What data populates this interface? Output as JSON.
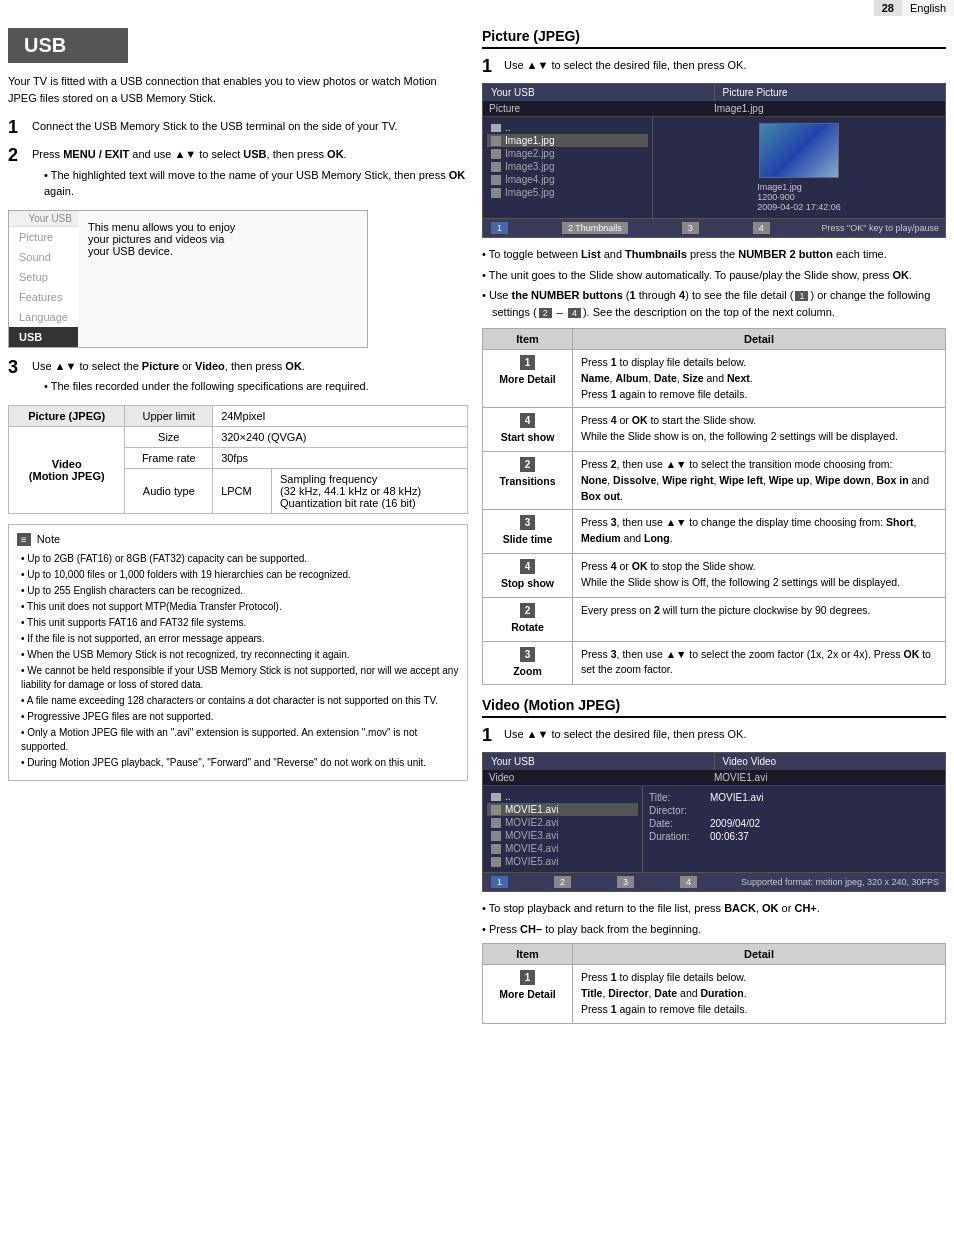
{
  "page": {
    "number": "28",
    "language": "English"
  },
  "left": {
    "usb_title": "USB",
    "intro": "Your TV is fitted with a USB connection that enables you to view photos or watch Motion JPEG files stored on a USB Memory Stick.",
    "step1_number": "1",
    "step1_text": "Connect the USB Memory Stick to the USB terminal on the side of your TV.",
    "step2_number": "2",
    "step2_text": "Press MENU / EXIT and use ▲▼ to select USB, then press OK.",
    "step2_bullet": "The highlighted text will move to the name of your USB Memory Stick, then press OK again.",
    "menu_items": [
      "Picture",
      "Sound",
      "Setup",
      "Features",
      "Language",
      "USB"
    ],
    "menu_your_usb": "Your USB",
    "menu_desc_line1": "This menu allows you to enjoy",
    "menu_desc_line2": "your pictures and videos via",
    "menu_desc_line3": "your USB device.",
    "step3_number": "3",
    "step3_text": "Use ▲▼ to select the Picture or Video, then press OK.",
    "step3_bullet": "The files recorded under the following specifications are required.",
    "spec_headers": [
      "Picture (JPEG)",
      "",
      "Upper limit",
      "24Mpixel"
    ],
    "spec_video_label": "Video\n(Motion JPEG)",
    "spec_size_label": "Size",
    "spec_size_value": "320×240 (QVGA)",
    "spec_frame_label": "Frame rate",
    "spec_frame_value": "30fps",
    "spec_audio_label": "Audio type",
    "spec_audio_codec": "LPCM",
    "spec_audio_desc": "Sampling frequency\n(32 kHz, 44.1 kHz or 48 kHz)\nQuantization bit rate (16 bit)",
    "note_label": "Note",
    "notes": [
      "Up to 2GB (FAT16) or 8GB (FAT32) capacity can be supported.",
      "Up to 10,000 files or 1,000 folders with 19 hierarchies can be recognized.",
      "Up to 255 English characters can be recognized.",
      "This unit does not support MTP(Media Transfer Protocol).",
      "This unit supports FAT16 and FAT32 file systems.",
      "If the file is not supported, an error message appears.",
      "When the USB Memory Stick is not recognized, try reconnecting it again.",
      "We cannot be held responsible if your USB Memory Stick is not supported, nor will we accept any liability for damage or loss of stored data.",
      "A file name exceeding 128 characters or contains a dot character is not supported on this TV.",
      "Progressive JPEG files are not supported.",
      "Only a Motion JPEG file with an \".avi\" extension is supported. An extension \".mov\" is not supported.",
      "During Motion JPEG playback, \"Pause\", \"Forward\" and \"Reverse\" do not work on this unit."
    ]
  },
  "right": {
    "picture_section_title": "Picture (JPEG)",
    "picture_step1_number": "1",
    "picture_step1_text": "Use ▲▼ to select the desired file, then press OK.",
    "usb_browser": {
      "col1_header": "Your USB",
      "col2_header": "Picture  Picture",
      "row_label": "Picture",
      "row_value": "Image1.jpg",
      "folder_icon": "..",
      "files": [
        "Image1.jpg",
        "Image2.jpg",
        "Image3.jpg",
        "Image4.jpg",
        "Image5.jpg"
      ],
      "active_file": "Image1.jpg",
      "preview_info_line1": "Image1.jpg",
      "preview_info_line2": "1200·900",
      "preview_info_line3": "2009-04-02 17:42:06",
      "ctrl_btn1": "1",
      "ctrl_btn2": "2  Thumbnails",
      "ctrl_btn3": "3",
      "ctrl_btn4": "4",
      "press_ok_text": "Press \"OK\" key to play/pause"
    },
    "picture_bullets": [
      "To toggle between List and Thumbnails press the NUMBER 2 button each time.",
      "The unit goes to the Slide show automatically. To pause/play the Slide show, press OK.",
      "Use the NUMBER buttons (1 through 4) to see the file detail (1) or change the following settings (2 – 4). See the description on the top of the next column."
    ],
    "detail_table_headers": [
      "Item",
      "Detail"
    ],
    "detail_rows": [
      {
        "item_num": "1",
        "item_label": "More Detail",
        "detail": "Press 1 to display file details below.\nName, Album, Date, Size and Next.\nPress 1 again to remove file details."
      },
      {
        "item_num": "4",
        "item_label": "Start show",
        "detail": "Press 4 or OK to start the Slide show.\nWhile the Slide show is on, the following 2 settings will be displayed."
      },
      {
        "item_num": "2",
        "item_label": "Transitions",
        "detail": "Press 2, then use ▲▼ to select the transition mode choosing from:\nNone, Dissolve, Wipe right, Wipe left, Wipe up, Wipe down, Box in and Box out."
      },
      {
        "item_num": "3",
        "item_label": "Slide time",
        "detail": "Press 3, then use ▲▼ to change the display time choosing from: Short, Medium and Long."
      },
      {
        "item_num": "4",
        "item_label": "Stop show",
        "detail": "Press 4 or OK to stop the Slide show.\nWhile the Slide show is Off, the following 2 settings will be displayed."
      },
      {
        "item_num": "2",
        "item_label": "Rotate",
        "detail": "Every press on 2 will turn the picture clockwise by 90 degrees."
      },
      {
        "item_num": "3",
        "item_label": "Zoom",
        "detail": "Press 3, then use ▲▼ to select the zoom factor (1x, 2x or 4x). Press OK to set the zoom factor."
      }
    ],
    "video_section_title": "Video (Motion JPEG)",
    "video_step1_number": "1",
    "video_step1_text": "Use ▲▼ to select the desired file, then press OK.",
    "video_browser": {
      "col1_header": "Your USB",
      "col2_header": "Video  Video",
      "row_label": "Video",
      "row_value": "MOVIE1.avi",
      "files": [
        "MOVIE1.avi",
        "MOVIE2.avi",
        "MOVIE3.avi",
        "MOVIE4.avi",
        "MOVIE5.avi"
      ],
      "active_file": "MOVIE1.avi",
      "info_title_label": "Title:",
      "info_title_value": "MOVIE1.avi",
      "info_director_label": "Director:",
      "info_director_value": "",
      "info_date_label": "Date:",
      "info_date_value": "2009/04/02",
      "info_duration_label": "Duration:",
      "info_duration_value": "00:06:37",
      "ctrl_btn1": "1",
      "ctrl_btn2": "2",
      "ctrl_btn3": "3",
      "ctrl_btn4": "4",
      "supported_format": "Supported format: motion jpeg, 320 x 240, 30FPS"
    },
    "video_bullets": [
      "To stop playback and return to the file list, press BACK, OK or CH+.",
      "Press CH– to play back from the beginning."
    ],
    "video_detail_table_headers": [
      "Item",
      "Detail"
    ],
    "video_detail_rows": [
      {
        "item_num": "1",
        "item_label": "More Detail",
        "detail": "Press 1 to display file details below.\nTitle, Director, Date and Duration.\nPress 1 again to remove file details."
      }
    ]
  }
}
